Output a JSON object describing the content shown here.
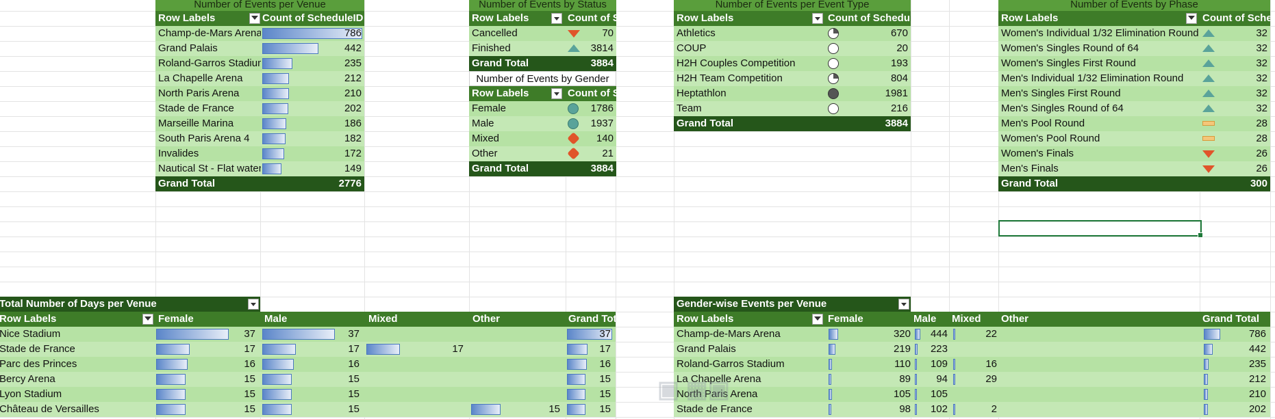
{
  "venue_pivot": {
    "title": "Number of Events per Venue",
    "col1": "Row Labels",
    "col2": "Count of ScheduleID",
    "rows": [
      {
        "label": "Champ-de-Mars Arena",
        "value": "786",
        "n": 786
      },
      {
        "label": "Grand Palais",
        "value": "442",
        "n": 442
      },
      {
        "label": "Roland-Garros Stadium",
        "value": "235",
        "n": 235
      },
      {
        "label": "La Chapelle Arena",
        "value": "212",
        "n": 212
      },
      {
        "label": "North Paris Arena",
        "value": "210",
        "n": 210
      },
      {
        "label": "Stade de France",
        "value": "202",
        "n": 202
      },
      {
        "label": "Marseille Marina",
        "value": "186",
        "n": 186
      },
      {
        "label": "South Paris Arena 4",
        "value": "182",
        "n": 182
      },
      {
        "label": "Invalides",
        "value": "172",
        "n": 172
      },
      {
        "label": "Nautical St - Flat water",
        "value": "149",
        "n": 149
      }
    ],
    "total_label": "Grand Total",
    "total": "2776"
  },
  "status_pivot": {
    "title": "Number of Events by Status",
    "col1": "Row Labels",
    "col2": "Count of ScheduleID",
    "rows": [
      {
        "label": "Cancelled",
        "value": "70",
        "icon": "arrow-down-icon"
      },
      {
        "label": "Finished",
        "value": "3814",
        "icon": "arrow-up-icon"
      }
    ],
    "total_label": "Grand Total",
    "total": "3884"
  },
  "gender_pivot": {
    "title": "Number of Events by Gender",
    "col1": "Row Labels",
    "col2": "Count of ScheduleID",
    "rows": [
      {
        "label": "Female",
        "value": "1786",
        "icon": "circle-icon"
      },
      {
        "label": "Male",
        "value": "1937",
        "icon": "circle-icon"
      },
      {
        "label": "Mixed",
        "value": "140",
        "icon": "diamond-icon"
      },
      {
        "label": "Other",
        "value": "21",
        "icon": "diamond-icon"
      }
    ],
    "total_label": "Grand Total",
    "total": "3884"
  },
  "type_pivot": {
    "title": "Number of Events per Event Type",
    "col1": "Row Labels",
    "col2": "Count of ScheduleID",
    "rows": [
      {
        "label": "Athletics",
        "value": "670",
        "icon": "quarter-circle-icon"
      },
      {
        "label": "COUP",
        "value": "20",
        "icon": "empty-circle-icon"
      },
      {
        "label": "H2H Couples Competition",
        "value": "193",
        "icon": "empty-circle-icon"
      },
      {
        "label": "H2H Team Competition",
        "value": "804",
        "icon": "quarter-circle-icon"
      },
      {
        "label": "Heptathlon",
        "value": "1981",
        "icon": "full-circle-icon"
      },
      {
        "label": "Team",
        "value": "216",
        "icon": "empty-circle-icon"
      }
    ],
    "total_label": "Grand Total",
    "total": "3884"
  },
  "phase_pivot": {
    "title": "Number of Events by Phase",
    "col1": "Row Labels",
    "col2": "Count of ScheduleID",
    "rows": [
      {
        "label": "Women's Individual 1/32 Elimination Round",
        "value": "32",
        "icon": "arrow-up-icon"
      },
      {
        "label": "Women's Singles Round of 64",
        "value": "32",
        "icon": "arrow-up-icon"
      },
      {
        "label": "Women's Singles First Round",
        "value": "32",
        "icon": "arrow-up-icon"
      },
      {
        "label": "Men's Individual 1/32 Elimination Round",
        "value": "32",
        "icon": "arrow-up-icon"
      },
      {
        "label": "Men's Singles First Round",
        "value": "32",
        "icon": "arrow-up-icon"
      },
      {
        "label": "Men's Singles Round of 64",
        "value": "32",
        "icon": "arrow-up-icon"
      },
      {
        "label": "Men's Pool Round",
        "value": "28",
        "icon": "dash-icon"
      },
      {
        "label": "Women's Pool Round",
        "value": "28",
        "icon": "dash-icon"
      },
      {
        "label": "Women's Finals",
        "value": "26",
        "icon": "arrow-down-icon"
      },
      {
        "label": "Men's Finals",
        "value": "26",
        "icon": "arrow-down-icon"
      }
    ],
    "total_label": "Grand Total",
    "total": "300"
  },
  "days_pivot": {
    "title": "Total Number of Days per Venue",
    "col_labels": [
      "Row Labels",
      "Female",
      "Male",
      "Mixed",
      "Other",
      "Grand Total"
    ],
    "rows": [
      {
        "label": "Nice Stadium",
        "female": "37",
        "male": "37",
        "mixed": "",
        "other": "",
        "total": "37",
        "fn": 37,
        "mn": 37,
        "xn": 0,
        "on": 0,
        "tn": 37
      },
      {
        "label": "Stade de France",
        "female": "17",
        "male": "17",
        "mixed": "17",
        "other": "",
        "total": "17",
        "fn": 17,
        "mn": 17,
        "xn": 17,
        "on": 0,
        "tn": 17
      },
      {
        "label": "Parc des Princes",
        "female": "16",
        "male": "16",
        "mixed": "",
        "other": "",
        "total": "16",
        "fn": 16,
        "mn": 16,
        "xn": 0,
        "on": 0,
        "tn": 16
      },
      {
        "label": "Bercy Arena",
        "female": "15",
        "male": "15",
        "mixed": "",
        "other": "",
        "total": "15",
        "fn": 15,
        "mn": 15,
        "xn": 0,
        "on": 0,
        "tn": 15
      },
      {
        "label": "Lyon Stadium",
        "female": "15",
        "male": "15",
        "mixed": "",
        "other": "",
        "total": "15",
        "fn": 15,
        "mn": 15,
        "xn": 0,
        "on": 0,
        "tn": 15
      },
      {
        "label": "Château de Versailles",
        "female": "15",
        "male": "15",
        "mixed": "",
        "other": "15",
        "total": "15",
        "fn": 15,
        "mn": 15,
        "xn": 0,
        "on": 15,
        "tn": 15
      }
    ]
  },
  "gender_venue_pivot": {
    "title": "Gender-wise Events per Venue",
    "col_labels": [
      "Row Labels",
      "Female",
      "Male",
      "Mixed",
      "Other",
      "Grand Total"
    ],
    "rows": [
      {
        "label": "Champ-de-Mars Arena",
        "female": "320",
        "male": "444",
        "mixed": "22",
        "total": "786",
        "fn": 320,
        "mn": 444,
        "xn": 22,
        "tn": 786
      },
      {
        "label": "Grand Palais",
        "female": "219",
        "male": "223",
        "mixed": "",
        "total": "442",
        "fn": 219,
        "mn": 223,
        "xn": 0,
        "tn": 442
      },
      {
        "label": "Roland-Garros Stadium",
        "female": "110",
        "male": "109",
        "mixed": "16",
        "total": "235",
        "fn": 110,
        "mn": 109,
        "xn": 16,
        "tn": 235
      },
      {
        "label": "La Chapelle Arena",
        "female": "89",
        "male": "94",
        "mixed": "29",
        "total": "212",
        "fn": 89,
        "mn": 94,
        "xn": 29,
        "tn": 212
      },
      {
        "label": "North Paris Arena",
        "female": "105",
        "male": "105",
        "mixed": "",
        "total": "210",
        "fn": 105,
        "mn": 105,
        "xn": 0,
        "tn": 210
      },
      {
        "label": "Stade de France",
        "female": "98",
        "male": "102",
        "mixed": "2",
        "total": "202",
        "fn": 98,
        "mn": 102,
        "xn": 2,
        "tn": 202
      }
    ]
  }
}
